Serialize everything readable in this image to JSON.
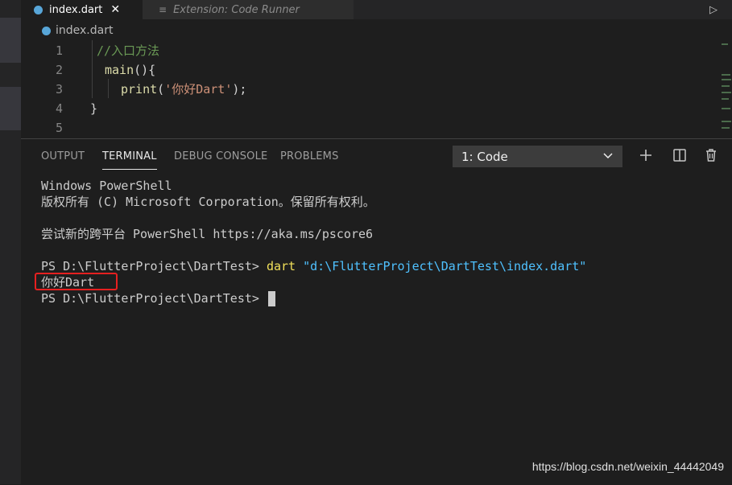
{
  "tabs": [
    {
      "label": "index.dart",
      "close": "✕"
    },
    {
      "label": "Extension: Code Runner"
    }
  ],
  "run_icon": "▷",
  "breadcrumb": "index.dart",
  "editor": {
    "lines": [
      {
        "num": "1",
        "comment": "//入口方法"
      },
      {
        "num": "2",
        "fn": "main",
        "rest": "(){"
      },
      {
        "num": "3",
        "fn": "print",
        "open": "(",
        "str": "'你好Dart'",
        "close": ");"
      },
      {
        "num": "4",
        "text": "}"
      },
      {
        "num": "5",
        "text": ""
      }
    ]
  },
  "panel": {
    "tabs": [
      "OUTPUT",
      "TERMINAL",
      "DEBUG CONSOLE",
      "PROBLEMS"
    ],
    "active_tab": "TERMINAL",
    "terminal_select": "1: Code",
    "icons": [
      "plus-icon",
      "split-icon",
      "trash-icon"
    ]
  },
  "terminal": {
    "line1": "Windows PowerShell",
    "line2": "版权所有 (C) Microsoft Corporation。保留所有权利。",
    "line3": "尝试新的跨平台 PowerShell https://aka.ms/pscore6",
    "prompt1": "PS D:\\FlutterProject\\DartTest> ",
    "cmd": "dart",
    "arg": "\"d:\\FlutterProject\\DartTest\\index.dart\"",
    "output": "你好Dart",
    "prompt2": "PS D:\\FlutterProject\\DartTest> "
  },
  "watermark": "https://blog.csdn.net/weixin_44442049",
  "colors": {
    "accent": "#58a6d8",
    "highlight": "#e62020",
    "comment": "#6a9955",
    "string": "#ce9178"
  }
}
